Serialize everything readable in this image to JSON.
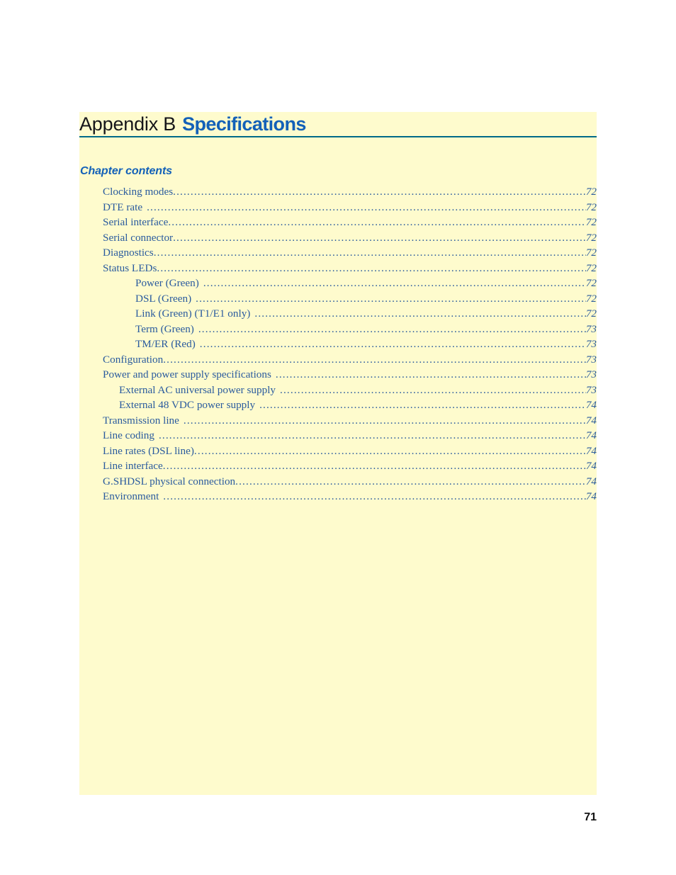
{
  "document": {
    "page_number": "71",
    "background_color": "#fefbcd",
    "rule_color": "#006a88",
    "accent_color": "#1361b8",
    "toc_text_color": "#2a5b9e"
  },
  "heading": {
    "appendix_label": "Appendix B",
    "appendix_name": "Specifications"
  },
  "contents": {
    "heading": "Chapter contents",
    "entries": [
      {
        "label": "Clocking modes",
        "page": "72",
        "level": 1,
        "gap": false
      },
      {
        "label": "DTE rate",
        "page": "72",
        "level": 1,
        "gap": true
      },
      {
        "label": "Serial interface",
        "page": "72",
        "level": 1,
        "gap": false
      },
      {
        "label": "Serial connector",
        "page": "72",
        "level": 1,
        "gap": false
      },
      {
        "label": "Diagnostics",
        "page": "72",
        "level": 1,
        "gap": false
      },
      {
        "label": "Status LEDs",
        "page": "72",
        "level": 1,
        "gap": false
      },
      {
        "label": "Power (Green)",
        "page": "72",
        "level": 3,
        "gap": true
      },
      {
        "label": "DSL (Green)",
        "page": "72",
        "level": 3,
        "gap": true
      },
      {
        "label": "Link (Green) (T1/E1 only)",
        "page": "72",
        "level": 3,
        "gap": true
      },
      {
        "label": "Term (Green)",
        "page": "73",
        "level": 3,
        "gap": true
      },
      {
        "label": "TM/ER (Red)",
        "page": "73",
        "level": 3,
        "gap": true
      },
      {
        "label": "Configuration",
        "page": "73",
        "level": 1,
        "gap": false
      },
      {
        "label": "Power and power supply specifications",
        "page": "73",
        "level": 1,
        "gap": true
      },
      {
        "label": "External AC universal power supply",
        "page": "73",
        "level": 2,
        "gap": true
      },
      {
        "label": "External 48 VDC power supply",
        "page": "74",
        "level": 2,
        "gap": true
      },
      {
        "label": "Transmission line",
        "page": "74",
        "level": 1,
        "gap": true
      },
      {
        "label": "Line coding",
        "page": "74",
        "level": 1,
        "gap": true
      },
      {
        "label": "Line rates (DSL line)",
        "page": "74",
        "level": 1,
        "gap": false
      },
      {
        "label": "Line interface",
        "page": "74",
        "level": 1,
        "gap": false
      },
      {
        "label": "G.SHDSL physical connection",
        "page": "74",
        "level": 1,
        "gap": false
      },
      {
        "label": "Environment",
        "page": "74",
        "level": 1,
        "gap": true
      }
    ]
  }
}
